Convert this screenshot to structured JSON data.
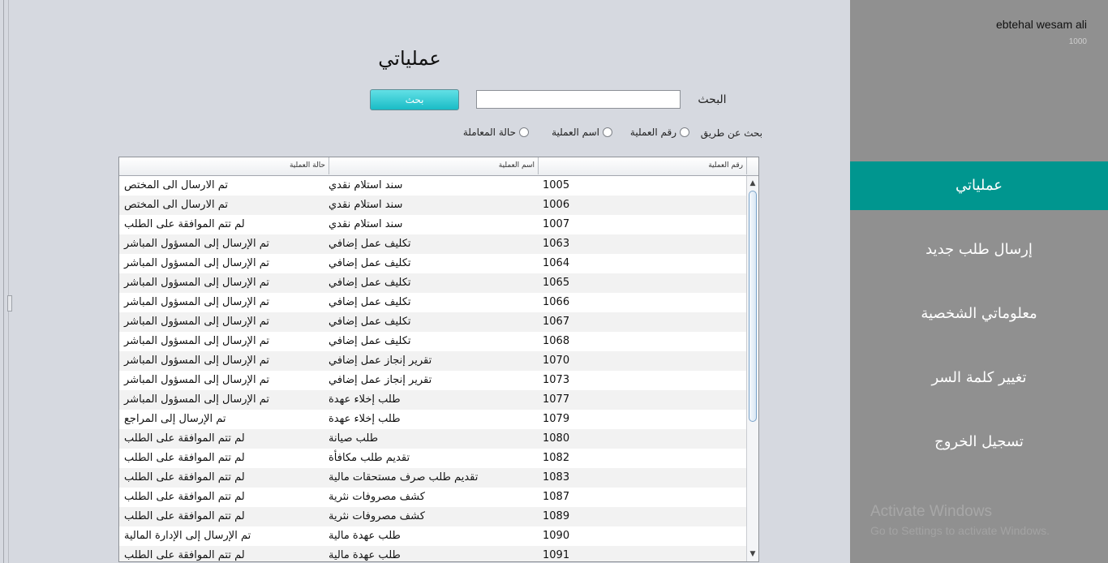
{
  "main": {
    "title": "عملياتي",
    "search": {
      "label": "البحث",
      "value": "",
      "placeholder": "",
      "button_label": "بحث"
    },
    "filter": {
      "prefix": "بحث عن طريق",
      "options": [
        "رقم العملية",
        "اسم العملية",
        "حالة المعاملة"
      ]
    },
    "table": {
      "columns": [
        "رقم العملية",
        "اسم العملية",
        "حالة العملية"
      ],
      "rows": [
        {
          "number": "1005",
          "name": "سند استلام نقدي",
          "status": "تم الارسال الى المختص"
        },
        {
          "number": "1006",
          "name": "سند استلام نقدي",
          "status": "تم الارسال الى المختص"
        },
        {
          "number": "1007",
          "name": "سند استلام نقدي",
          "status": "لم تتم الموافقة على الطلب"
        },
        {
          "number": "1063",
          "name": "تكليف عمل إضافي",
          "status": "تم الإرسال إلى المسؤول المباشر"
        },
        {
          "number": "1064",
          "name": "تكليف عمل إضافي",
          "status": "تم الإرسال إلى المسؤول المباشر"
        },
        {
          "number": "1065",
          "name": "تكليف عمل إضافي",
          "status": "تم الإرسال إلى المسؤول المباشر"
        },
        {
          "number": "1066",
          "name": "تكليف عمل إضافي",
          "status": "تم الإرسال إلى المسؤول المباشر"
        },
        {
          "number": "1067",
          "name": "تكليف عمل إضافي",
          "status": "تم الإرسال إلى المسؤول المباشر"
        },
        {
          "number": "1068",
          "name": "تكليف عمل إضافي",
          "status": "تم الإرسال إلى المسؤول المباشر"
        },
        {
          "number": "1070",
          "name": "تقرير إنجاز عمل إضافي",
          "status": "تم الإرسال إلى المسؤول المباشر"
        },
        {
          "number": "1073",
          "name": "تقرير إنجاز عمل إضافي",
          "status": "تم الإرسال إلى المسؤول المباشر"
        },
        {
          "number": "1077",
          "name": "طلب إخلاء عهدة",
          "status": "تم الإرسال إلى المسؤول المباشر"
        },
        {
          "number": "1079",
          "name": "طلب إخلاء عهدة",
          "status": "تم الإرسال إلى المراجع"
        },
        {
          "number": "1080",
          "name": "طلب صيانة",
          "status": "لم تتم الموافقة على الطلب"
        },
        {
          "number": "1082",
          "name": "تقديم طلب مكافأة",
          "status": "لم تتم الموافقة على الطلب"
        },
        {
          "number": "1083",
          "name": "تقديم طلب صرف مستحقات مالية",
          "status": "لم تتم الموافقة على الطلب"
        },
        {
          "number": "1087",
          "name": "كشف مصروفات نثرية",
          "status": "لم تتم الموافقة على الطلب"
        },
        {
          "number": "1089",
          "name": "كشف مصروفات نثرية",
          "status": "لم تتم الموافقة على الطلب"
        },
        {
          "number": "1090",
          "name": "طلب عهدة مالية",
          "status": "تم الإرسال إلى الإدارة المالية"
        },
        {
          "number": "1091",
          "name": "طلب عهدة مالية",
          "status": "لم تتم الموافقة على الطلب"
        }
      ]
    }
  },
  "sidebar": {
    "user_name": "ebtehal wesam ali",
    "user_id": "1000",
    "items": [
      {
        "label": "عملياتي",
        "active": true
      },
      {
        "label": "إرسال طلب جديد",
        "active": false
      },
      {
        "label": "معلوماتي الشخصية",
        "active": false
      },
      {
        "label": "تغيير كلمة السر",
        "active": false
      },
      {
        "label": "تسجيل الخروج",
        "active": false
      }
    ]
  },
  "watermark": {
    "line1": "Activate Windows",
    "line2": "Go to Settings to activate Windows."
  },
  "colors": {
    "background": "#d6d9e0",
    "sidebar": "#909090",
    "active_item": "#00968f",
    "search_button": "#19bcc6"
  }
}
